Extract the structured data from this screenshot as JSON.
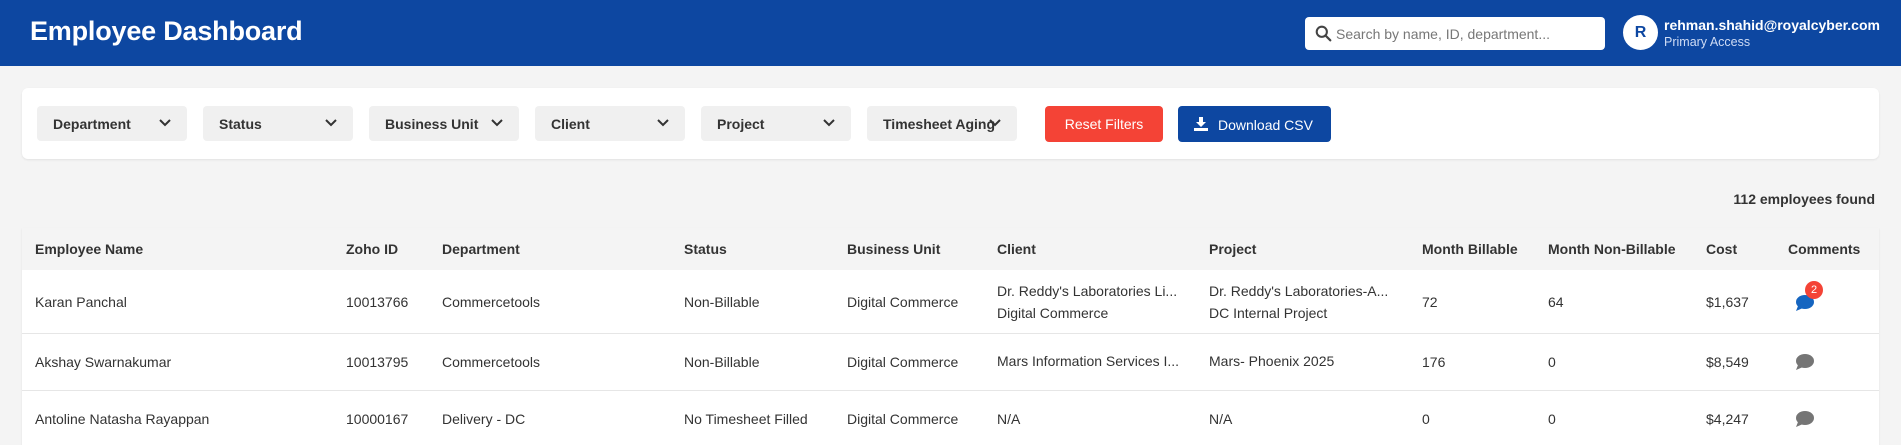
{
  "header": {
    "title": "Employee Dashboard",
    "search_placeholder": "Search by name, ID, department...",
    "avatar_initial": "R",
    "user_email": "rehman.shahid@royalcyber.com",
    "user_access": "Primary Access",
    "brand_color": "#0d47a1"
  },
  "filters": {
    "dropdowns": [
      "Department",
      "Status",
      "Business Unit",
      "Client",
      "Project",
      "Timesheet Aging"
    ],
    "reset_label": "Reset Filters",
    "download_label": "Download CSV",
    "reset_color": "#f44336"
  },
  "results_count": "112 employees found",
  "table": {
    "columns": [
      "Employee Name",
      "Zoho ID",
      "Department",
      "Status",
      "Business Unit",
      "Client",
      "Project",
      "Month Billable",
      "Month Non-Billable",
      "Cost",
      "Comments"
    ],
    "rows": [
      {
        "name": "Karan Panchal",
        "zoho_id": "10013766",
        "department": "Commercetools",
        "status": "Non-Billable",
        "business_unit": "Digital Commerce",
        "client": [
          "Dr. Reddy's Laboratories Li...",
          "Digital Commerce"
        ],
        "project": [
          "Dr. Reddy's Laboratories-A...",
          "DC Internal Project"
        ],
        "month_billable": "72",
        "month_non_billable": "64",
        "cost": "$1,637",
        "comment_icon": "comment-icon",
        "comment_count": "2",
        "comment_color": "#1565c0"
      },
      {
        "name": "Akshay Swarnakumar",
        "zoho_id": "10013795",
        "department": "Commercetools",
        "status": "Non-Billable",
        "business_unit": "Digital Commerce",
        "client": [
          "Mars Information Services I..."
        ],
        "project": [
          "Mars- Phoenix 2025"
        ],
        "month_billable": "176",
        "month_non_billable": "0",
        "cost": "$8,549",
        "comment_icon": "comment-icon",
        "comment_count": "",
        "comment_color": "#757575"
      },
      {
        "name": "Antoline Natasha Rayappan",
        "zoho_id": "10000167",
        "department": "Delivery - DC",
        "status": "No Timesheet Filled",
        "business_unit": "Digital Commerce",
        "client": [
          "N/A"
        ],
        "project": [
          "N/A"
        ],
        "month_billable": "0",
        "month_non_billable": "0",
        "cost": "$4,247",
        "comment_icon": "comment-icon",
        "comment_count": "",
        "comment_color": "#757575"
      }
    ]
  }
}
